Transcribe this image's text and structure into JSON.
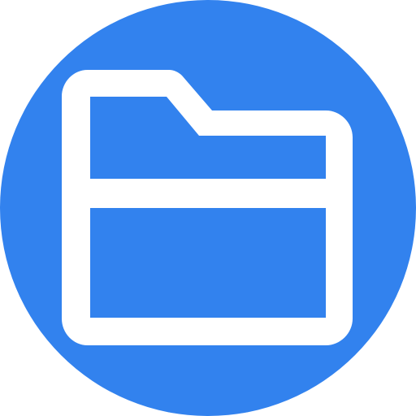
{
  "icon": {
    "name": "folder-icon",
    "background_shape": "circle",
    "background_color": "#3282EE",
    "foreground_color": "#FFFFFF"
  }
}
